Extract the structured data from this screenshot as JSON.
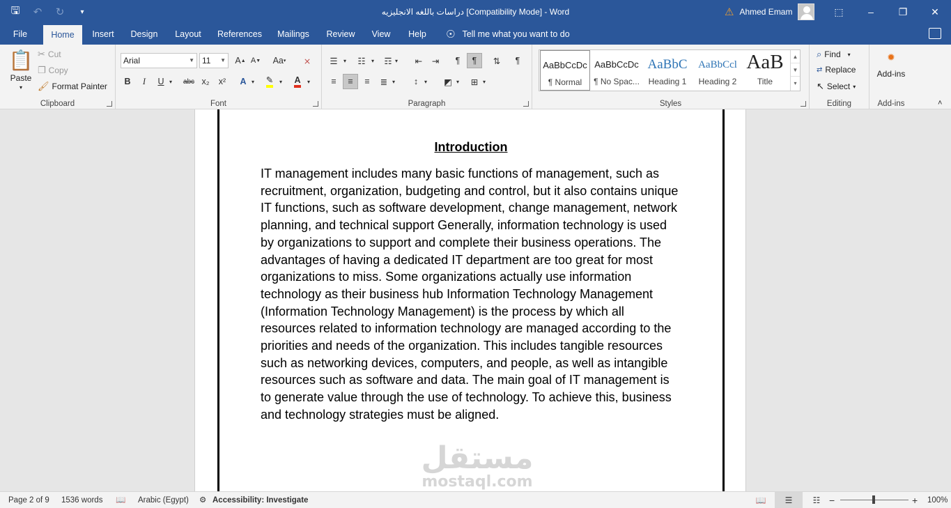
{
  "app": {
    "title": "دراسات باللغه الانجليزيه [Compatibility Mode]  -  Word",
    "user_name": "Ahmed Emam"
  },
  "quick_access": {
    "save_icon": "save-icon",
    "undo_icon": "undo-icon",
    "redo_icon": "redo-icon"
  },
  "tabs": [
    "File",
    "Home",
    "Insert",
    "Design",
    "Layout",
    "References",
    "Mailings",
    "Review",
    "View",
    "Help"
  ],
  "active_tab": "Home",
  "tell_me": "Tell me what you want to do",
  "clipboard": {
    "paste": "Paste",
    "cut": "Cut",
    "copy": "Copy",
    "format_painter": "Format Painter",
    "label": "Clipboard"
  },
  "font": {
    "name": "Arial",
    "size": "11",
    "label": "Font",
    "bold": "B",
    "italic": "I",
    "underline": "U",
    "strike": "abc",
    "subscript": "x₂",
    "superscript": "x²",
    "grow": "A",
    "shrink": "A",
    "case": "Aa",
    "text_effects": "A",
    "font_color": "A",
    "font_color_value": "#e0301e",
    "highlight_value": "#ffff00"
  },
  "paragraph": {
    "label": "Paragraph"
  },
  "styles": {
    "label": "Styles",
    "items": [
      {
        "preview": "AaBbCcDc",
        "name": "¶ Normal"
      },
      {
        "preview": "AaBbCcDc",
        "name": "¶ No Spac..."
      },
      {
        "preview": "AaBbC",
        "name": "Heading 1"
      },
      {
        "preview": "AaBbCcl",
        "name": "Heading 2"
      },
      {
        "preview": "AaB",
        "name": "Title"
      }
    ]
  },
  "editing": {
    "label": "Editing",
    "find": "Find",
    "replace": "Replace",
    "select": "Select"
  },
  "addins": {
    "button": "Add-ins",
    "label": "Add-ins"
  },
  "document": {
    "heading": "Introduction",
    "body": "IT management includes many basic functions of management, such as recruitment, organization, budgeting and control, but it also contains unique IT functions, such as software development, change management, network planning, and technical support Generally, information technology is used by organizations to support and complete their business operations. The advantages of having a dedicated IT department are too great for most organizations to miss. Some organizations actually use information technology as their business hub Information Technology Management (Information Technology Management) is the process by which all resources related to information technology are managed according to the priorities and needs of the organization. This includes tangible resources such as networking devices, computers, and people, as well as intangible resources such as software and data. The main goal of IT management is to generate value through the use of technology. To achieve this, business and technology strategies must be aligned.",
    "watermark_ar": "مستقل",
    "watermark_en": "mostaql.com"
  },
  "status": {
    "page": "Page 2 of 9",
    "words": "1536 words",
    "language": "Arabic (Egypt)",
    "accessibility": "Accessibility: Investigate",
    "zoom": "100%",
    "zoom_minus": "−",
    "zoom_plus": "+"
  }
}
